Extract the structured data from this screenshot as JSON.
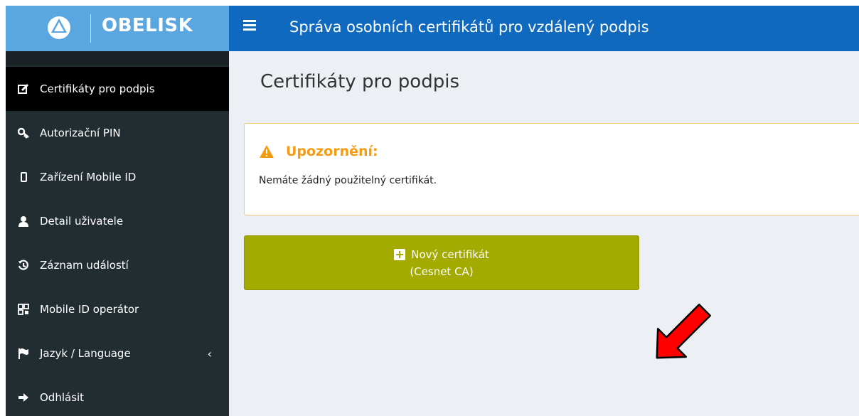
{
  "brand": {
    "name": "OBELISK"
  },
  "header": {
    "title": "Správa osobních certifikátů pro vzdálený podpis",
    "menu_icon": "hamburger-icon"
  },
  "sidebar": {
    "items": [
      {
        "label": "Certifikáty pro podpis",
        "icon": "edit-icon",
        "active": true
      },
      {
        "label": "Autorizační PIN",
        "icon": "key-icon"
      },
      {
        "label": "Zařízení Mobile ID",
        "icon": "mobile-icon"
      },
      {
        "label": "Detail uživatele",
        "icon": "user-icon"
      },
      {
        "label": "Záznam událostí",
        "icon": "history-icon"
      },
      {
        "label": "Mobile ID operátor",
        "icon": "qrcode-icon"
      },
      {
        "label": "Jazyk / Language",
        "icon": "flag-icon",
        "submenu": "‹"
      },
      {
        "label": "Odhlásit",
        "icon": "sign-out-icon"
      }
    ]
  },
  "main": {
    "title": "Certifikáty pro podpis",
    "alert": {
      "title": "Upozornění:",
      "text": "Nemáte žádný použitelný certifikát."
    },
    "new_cert_button": {
      "line1": "Nový certifikát",
      "line2": "(Cesnet CA)"
    }
  },
  "colors": {
    "brand_bg": "#5aa6e0",
    "header_bg": "#0f6abf",
    "sidebar_bg": "#222d32",
    "content_bg": "#ecf0f5",
    "warning": "#f39c12",
    "button_bg": "#a3ab00",
    "arrow": "#ff0000"
  }
}
